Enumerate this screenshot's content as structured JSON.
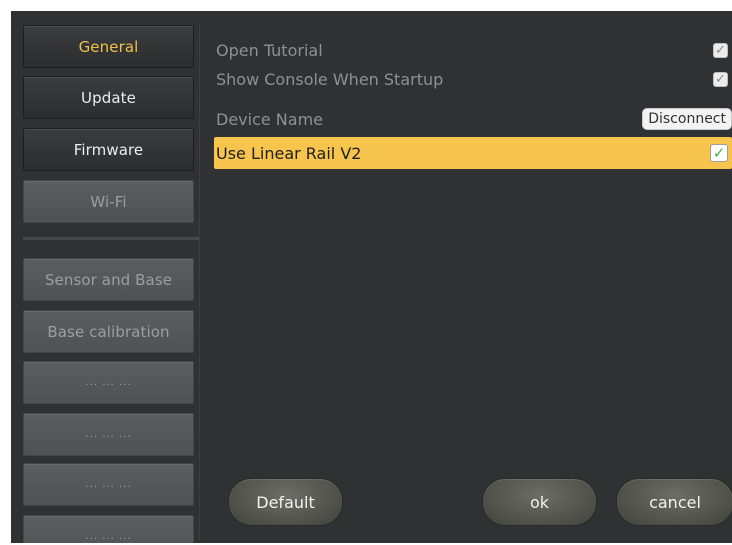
{
  "sidebar": {
    "items": [
      {
        "label": "General"
      },
      {
        "label": "Update"
      },
      {
        "label": "Firmware"
      },
      {
        "label": "Wi-Fi"
      },
      {
        "label": "Sensor and Base"
      },
      {
        "label": "Base calibration"
      },
      {
        "label": "... ... ..."
      },
      {
        "label": "... ... ..."
      },
      {
        "label": "... ... ..."
      },
      {
        "label": "... ... ..."
      }
    ]
  },
  "settings": {
    "open_tutorial": {
      "label": "Open Tutorial",
      "checked": true
    },
    "show_console": {
      "label": "Show Console When Startup",
      "checked": true
    },
    "device_name": {
      "label": "Device Name",
      "button_label": "Disconnect"
    },
    "linear_rail": {
      "label": "Use Linear Rail V2",
      "checked": true
    }
  },
  "footer": {
    "default_label": "Default",
    "ok_label": "ok",
    "cancel_label": "cancel"
  },
  "colors": {
    "accent": "#f7c54d",
    "active_text": "#f0c14a",
    "background": "#2f3133",
    "check_green": "#45b53a"
  }
}
